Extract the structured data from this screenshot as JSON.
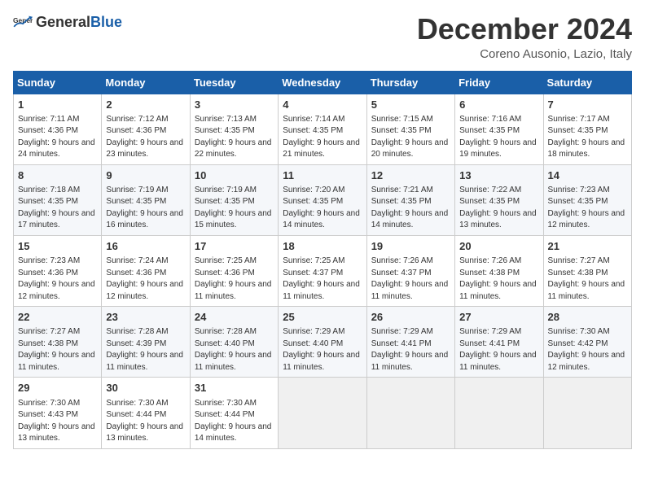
{
  "logo": {
    "general": "General",
    "blue": "Blue"
  },
  "title": "December 2024",
  "subtitle": "Coreno Ausonio, Lazio, Italy",
  "days_header": [
    "Sunday",
    "Monday",
    "Tuesday",
    "Wednesday",
    "Thursday",
    "Friday",
    "Saturday"
  ],
  "weeks": [
    [
      {
        "day": "1",
        "sunrise": "7:11 AM",
        "sunset": "4:36 PM",
        "daylight": "9 hours and 24 minutes."
      },
      {
        "day": "2",
        "sunrise": "7:12 AM",
        "sunset": "4:36 PM",
        "daylight": "9 hours and 23 minutes."
      },
      {
        "day": "3",
        "sunrise": "7:13 AM",
        "sunset": "4:35 PM",
        "daylight": "9 hours and 22 minutes."
      },
      {
        "day": "4",
        "sunrise": "7:14 AM",
        "sunset": "4:35 PM",
        "daylight": "9 hours and 21 minutes."
      },
      {
        "day": "5",
        "sunrise": "7:15 AM",
        "sunset": "4:35 PM",
        "daylight": "9 hours and 20 minutes."
      },
      {
        "day": "6",
        "sunrise": "7:16 AM",
        "sunset": "4:35 PM",
        "daylight": "9 hours and 19 minutes."
      },
      {
        "day": "7",
        "sunrise": "7:17 AM",
        "sunset": "4:35 PM",
        "daylight": "9 hours and 18 minutes."
      }
    ],
    [
      {
        "day": "8",
        "sunrise": "7:18 AM",
        "sunset": "4:35 PM",
        "daylight": "9 hours and 17 minutes."
      },
      {
        "day": "9",
        "sunrise": "7:19 AM",
        "sunset": "4:35 PM",
        "daylight": "9 hours and 16 minutes."
      },
      {
        "day": "10",
        "sunrise": "7:19 AM",
        "sunset": "4:35 PM",
        "daylight": "9 hours and 15 minutes."
      },
      {
        "day": "11",
        "sunrise": "7:20 AM",
        "sunset": "4:35 PM",
        "daylight": "9 hours and 14 minutes."
      },
      {
        "day": "12",
        "sunrise": "7:21 AM",
        "sunset": "4:35 PM",
        "daylight": "9 hours and 14 minutes."
      },
      {
        "day": "13",
        "sunrise": "7:22 AM",
        "sunset": "4:35 PM",
        "daylight": "9 hours and 13 minutes."
      },
      {
        "day": "14",
        "sunrise": "7:23 AM",
        "sunset": "4:35 PM",
        "daylight": "9 hours and 12 minutes."
      }
    ],
    [
      {
        "day": "15",
        "sunrise": "7:23 AM",
        "sunset": "4:36 PM",
        "daylight": "9 hours and 12 minutes."
      },
      {
        "day": "16",
        "sunrise": "7:24 AM",
        "sunset": "4:36 PM",
        "daylight": "9 hours and 12 minutes."
      },
      {
        "day": "17",
        "sunrise": "7:25 AM",
        "sunset": "4:36 PM",
        "daylight": "9 hours and 11 minutes."
      },
      {
        "day": "18",
        "sunrise": "7:25 AM",
        "sunset": "4:37 PM",
        "daylight": "9 hours and 11 minutes."
      },
      {
        "day": "19",
        "sunrise": "7:26 AM",
        "sunset": "4:37 PM",
        "daylight": "9 hours and 11 minutes."
      },
      {
        "day": "20",
        "sunrise": "7:26 AM",
        "sunset": "4:38 PM",
        "daylight": "9 hours and 11 minutes."
      },
      {
        "day": "21",
        "sunrise": "7:27 AM",
        "sunset": "4:38 PM",
        "daylight": "9 hours and 11 minutes."
      }
    ],
    [
      {
        "day": "22",
        "sunrise": "7:27 AM",
        "sunset": "4:38 PM",
        "daylight": "9 hours and 11 minutes."
      },
      {
        "day": "23",
        "sunrise": "7:28 AM",
        "sunset": "4:39 PM",
        "daylight": "9 hours and 11 minutes."
      },
      {
        "day": "24",
        "sunrise": "7:28 AM",
        "sunset": "4:40 PM",
        "daylight": "9 hours and 11 minutes."
      },
      {
        "day": "25",
        "sunrise": "7:29 AM",
        "sunset": "4:40 PM",
        "daylight": "9 hours and 11 minutes."
      },
      {
        "day": "26",
        "sunrise": "7:29 AM",
        "sunset": "4:41 PM",
        "daylight": "9 hours and 11 minutes."
      },
      {
        "day": "27",
        "sunrise": "7:29 AM",
        "sunset": "4:41 PM",
        "daylight": "9 hours and 11 minutes."
      },
      {
        "day": "28",
        "sunrise": "7:30 AM",
        "sunset": "4:42 PM",
        "daylight": "9 hours and 12 minutes."
      }
    ],
    [
      {
        "day": "29",
        "sunrise": "7:30 AM",
        "sunset": "4:43 PM",
        "daylight": "9 hours and 13 minutes."
      },
      {
        "day": "30",
        "sunrise": "7:30 AM",
        "sunset": "4:44 PM",
        "daylight": "9 hours and 13 minutes."
      },
      {
        "day": "31",
        "sunrise": "7:30 AM",
        "sunset": "4:44 PM",
        "daylight": "9 hours and 14 minutes."
      },
      null,
      null,
      null,
      null
    ]
  ]
}
